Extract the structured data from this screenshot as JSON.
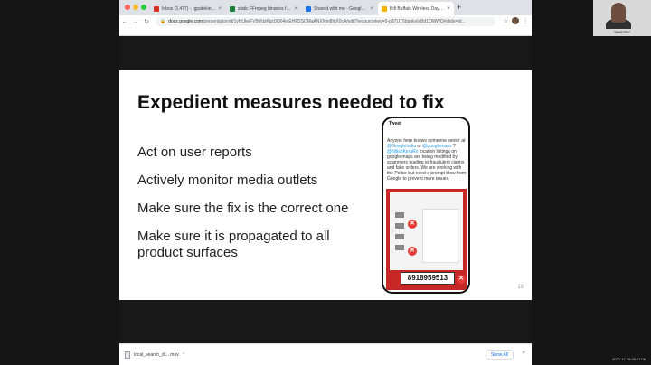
{
  "browser": {
    "tabs": [
      {
        "title": "Inbox (2,477) - rgpatekin@gm",
        "fav_color": "#d93025",
        "active": false
      },
      {
        "title": "static FFmpeg binaries for ma",
        "fav_color": "#188038",
        "active": false
      },
      {
        "title": "Shared with me - Google Drive",
        "fav_color": "#1a73e8",
        "active": false
      },
      {
        "title": "Bifi Buffalo Wireless Day Prop",
        "fav_color": "#f4b400",
        "active": true
      }
    ],
    "new_tab": "+",
    "close_glyph": "×",
    "nav": {
      "back": "←",
      "forward": "→",
      "reload": "↻"
    },
    "url_domain": "docs.google.com",
    "url_path": "/presentation/d/1yHUkeFV9hNzKgc0Q04mEHR2SCMaANXNm8hjX0cA/edit?resourcekey=0-p37UT5bpokvIxBd1OMWQ#slide=id...",
    "lock_icon": "lock-icon",
    "toolbar_icons": [
      "☆",
      "⋮"
    ]
  },
  "slide": {
    "title": "Expedient measures needed to fix",
    "bullets": [
      "Act on user reports",
      "Actively monitor media outlets",
      "Make sure the fix is the correct one",
      "Make sure it is propagated to all product surfaces"
    ],
    "slide_number": "19"
  },
  "tweet": {
    "header": "Tweet",
    "text_prefix": "Anyone here knows someone senior at ",
    "mention1": "@GoogleIndia",
    "text_or": " or ",
    "mention2": "@googlemaps",
    "text_q": " ?",
    "mention3": "@NitishKeruRo",
    "text_body": " location listings on google maps are being modified by scammers leading to fraudulent claims and fake orders. We are working with the Police but need a prompt blow from Google to prevent more issues.",
    "phone_number": "8918959513"
  },
  "webcam": {
    "name": "Rajesh Patel"
  },
  "downloads": {
    "file_name": "local_search_di....mov",
    "show_all": "Show All",
    "close": "×"
  },
  "clock": "2022-11-16 09:21:08"
}
